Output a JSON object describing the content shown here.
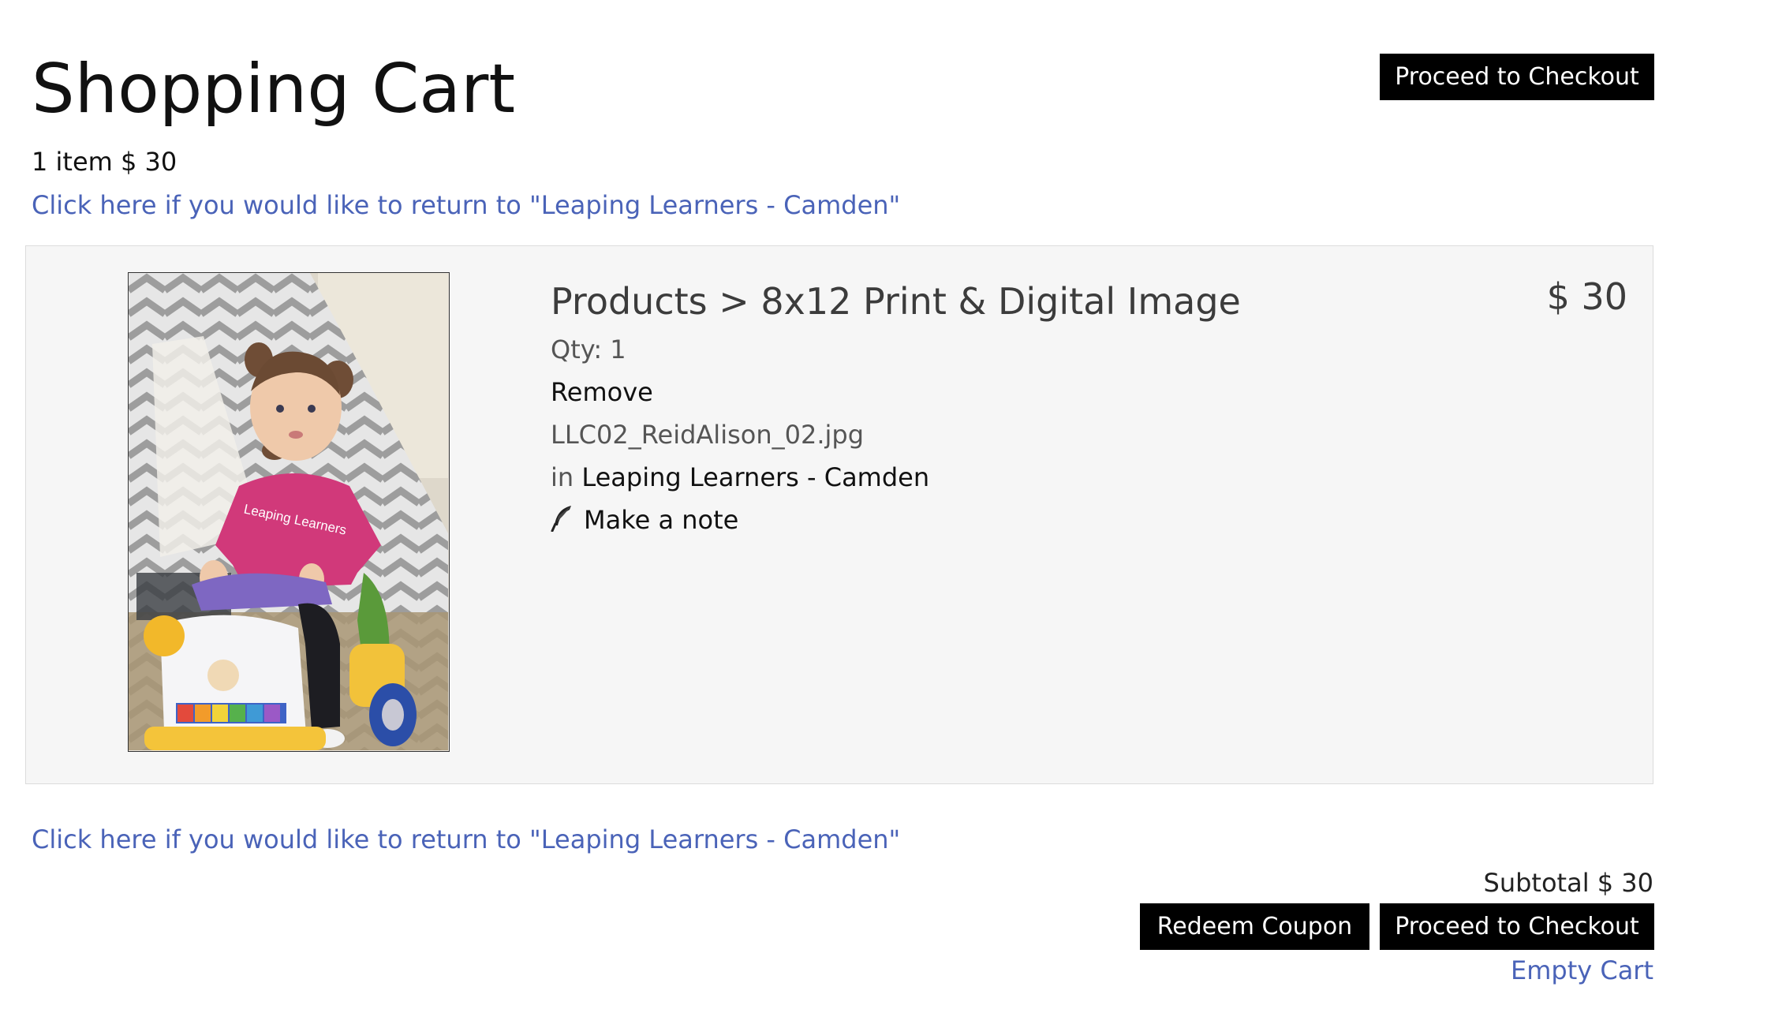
{
  "header": {
    "title": "Shopping Cart",
    "summary": "1 item $ 30",
    "checkout_label": "Proceed to Checkout"
  },
  "return_link": "Click here if you would like to return to \"Leaping Learners - Camden\"",
  "cart_item": {
    "breadcrumb": "Products > 8x12 Print & Digital Image",
    "price": "$ 30",
    "qty": "Qty: 1",
    "remove_label": "Remove",
    "filename": "LLC02_ReidAlison_02.jpg",
    "in_prefix": "in",
    "gallery_name": "Leaping Learners - Camden",
    "note_label": "Make a note",
    "note_icon": "quill-icon",
    "shirt_text": "Leaping Learners"
  },
  "footer": {
    "subtotal": "Subtotal $ 30",
    "coupon_label": "Redeem Coupon",
    "checkout_label": "Proceed to Checkout",
    "empty_cart_label": "Empty Cart"
  },
  "colors": {
    "link": "#4a63b8",
    "button_bg": "#000000",
    "panel_bg": "#f6f6f6"
  }
}
